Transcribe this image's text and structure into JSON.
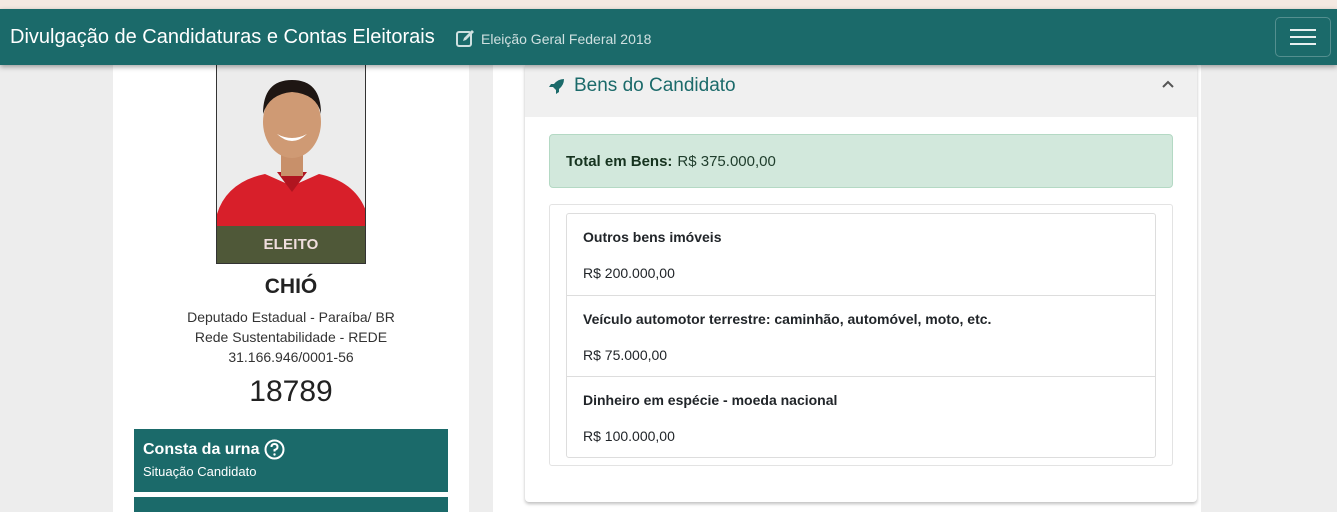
{
  "header": {
    "brand": "Divulgação de Candidaturas e Contas Eleitorais",
    "election": "Eleição Geral Federal 2018"
  },
  "candidate": {
    "badge": "ELEITO",
    "name": "CHIÓ",
    "role": "Deputado Estadual - Paraíba/ BR",
    "party": "Rede Sustentabilidade - REDE",
    "cnpj": "31.166.946/0001-56",
    "number": "18789",
    "status_title": "Consta da urna",
    "status_sub": "Situação Candidato"
  },
  "bens": {
    "title": "Bens do Candidato",
    "total_label": "Total em Bens:",
    "total_value": "R$ 375.000,00",
    "items": [
      {
        "description": "Outros bens imóveis",
        "value": "R$ 200.000,00"
      },
      {
        "description": "Veículo automotor terrestre: caminhão, automóvel, moto, etc.",
        "value": "R$ 75.000,00"
      },
      {
        "description": "Dinheiro em espécie - moeda nacional",
        "value": "R$ 100.000,00"
      }
    ]
  },
  "colors": {
    "primary": "#1b6a6a",
    "success_bg": "#d2e8dc",
    "elected_badge": "#28693c"
  }
}
